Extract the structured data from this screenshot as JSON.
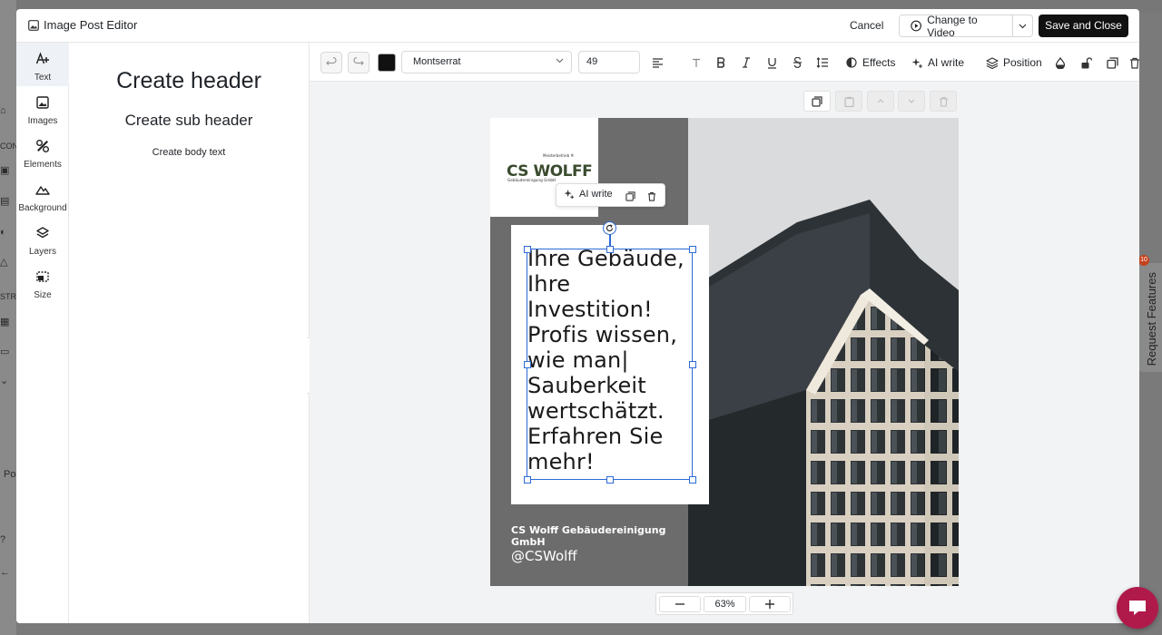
{
  "background_app": {
    "left_labels": [
      "CON",
      "STRA",
      "Po"
    ],
    "request_features": "Request Features",
    "badge_count": "10"
  },
  "modal": {
    "title": "Image Post Editor",
    "cancel_label": "Cancel",
    "change_to_video_label": "Change to Video",
    "save_close_label": "Save and Close"
  },
  "rail": {
    "items": [
      {
        "label": "Text",
        "icon": "text-add-icon"
      },
      {
        "label": "Images",
        "icon": "image-icon"
      },
      {
        "label": "Elements",
        "icon": "shapes-icon"
      },
      {
        "label": "Background",
        "icon": "mountain-icon"
      },
      {
        "label": "Layers",
        "icon": "layers-icon"
      },
      {
        "label": "Size",
        "icon": "resize-icon"
      }
    ]
  },
  "text_panel": {
    "header": "Create header",
    "sub_header": "Create sub header",
    "body": "Create body text"
  },
  "toolbar": {
    "text_color": "#111111",
    "font_family": "Montserrat",
    "font_size": "49",
    "effects_label": "Effects",
    "ai_write_label": "AI write",
    "position_label": "Position"
  },
  "post": {
    "text": "Ihre Gebäude,\nIhre Investition!\nProfis wissen,\nwie man|\nSauberkeit\nwertschätzt.\nErfahren Sie\nmehr!",
    "company": "CS Wolff Gebäudereinigung GmbH",
    "handle": "@CSWolff",
    "logo_main": "CS WOLFF",
    "logo_top": "Meisterbetrieb ®",
    "logo_sub": "Gebäudereinigung GmbH"
  },
  "float_bar": {
    "ai_write_label": "AI write"
  },
  "zoom": {
    "value": "63%"
  }
}
